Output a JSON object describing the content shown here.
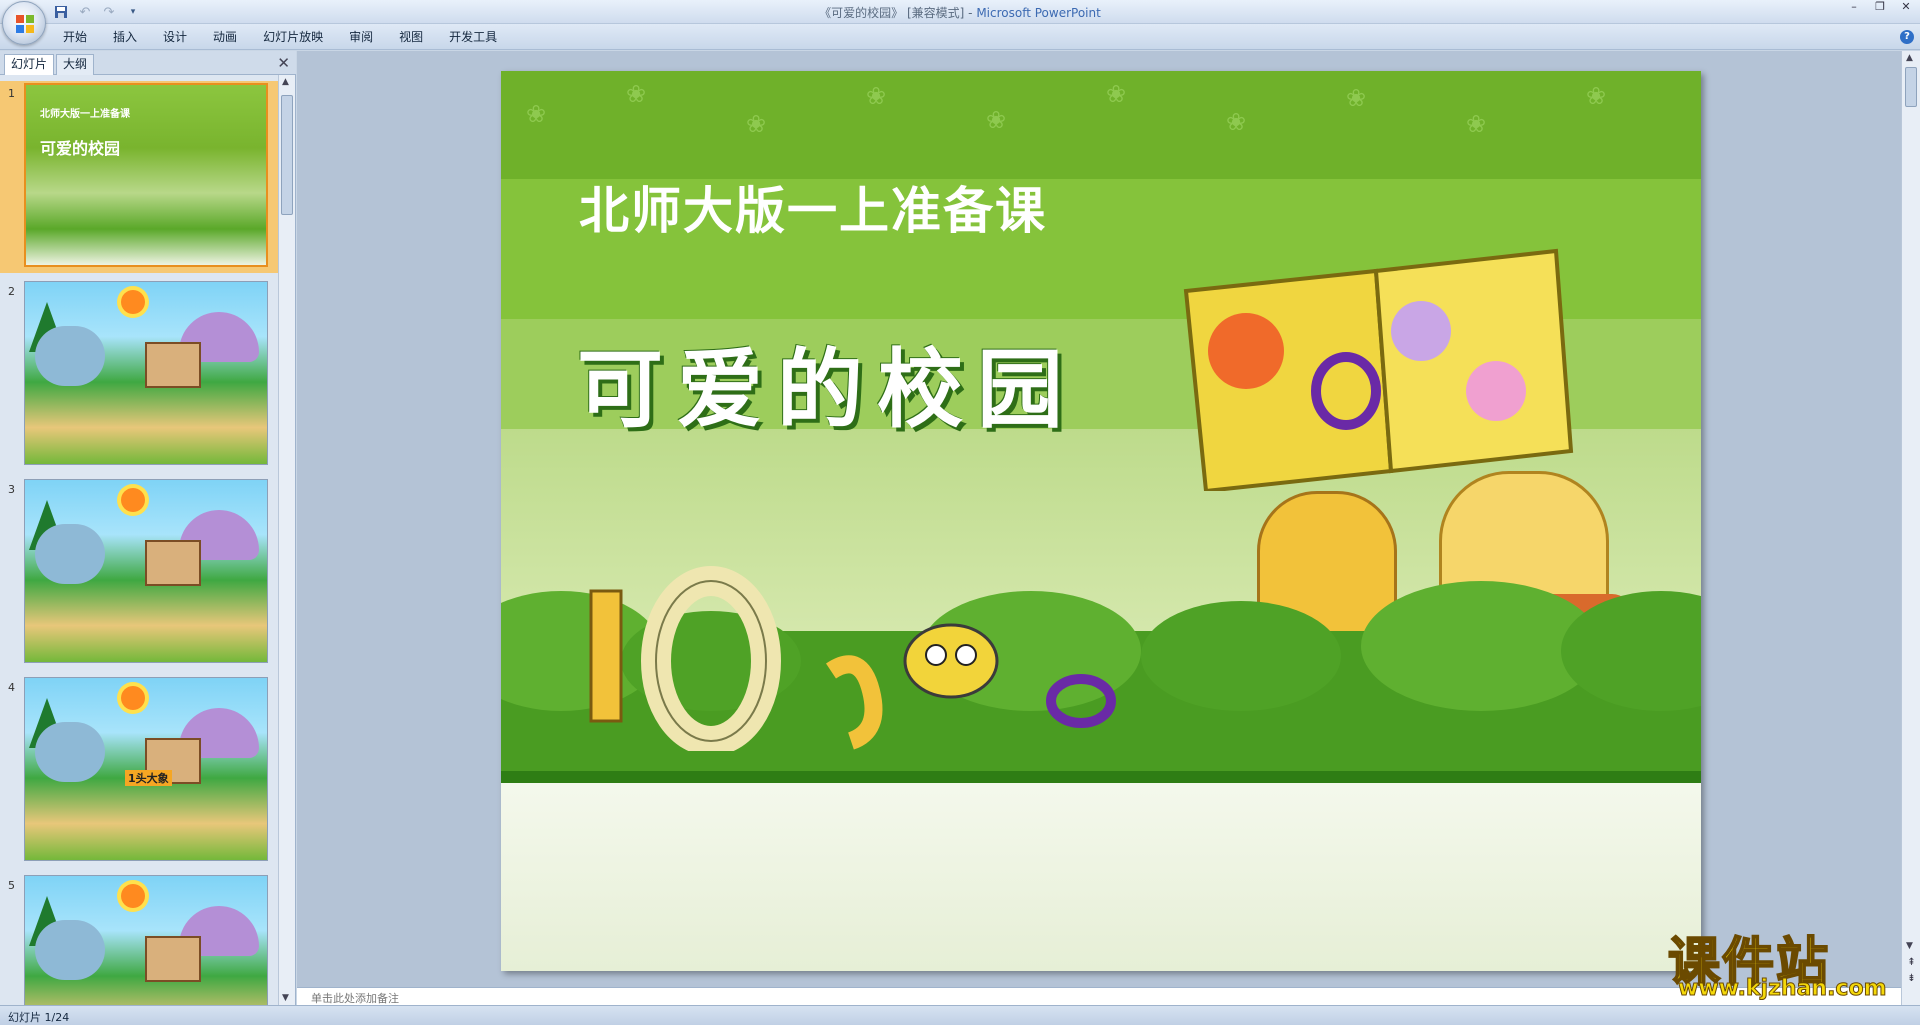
{
  "window": {
    "title_prefix": "《可爱的校园》 [兼容模式] - ",
    "app_name": "Microsoft PowerPoint",
    "minimize": "–",
    "restore": "❐",
    "close": "✕"
  },
  "quick_access": {
    "save_icon": "save-icon",
    "undo_icon": "undo-icon",
    "redo_icon": "redo-icon",
    "customize_icon": "customize-qat-icon"
  },
  "ribbon": {
    "tabs": [
      "开始",
      "插入",
      "设计",
      "动画",
      "幻灯片放映",
      "审阅",
      "视图",
      "开发工具"
    ],
    "help": "?"
  },
  "left_pane": {
    "tab_slides": "幻灯片",
    "tab_outline": "大纲",
    "close": "✕",
    "thumbnails": [
      {
        "num": "1",
        "line1": "北师大版一上准备课",
        "line2": "可爱的校园",
        "selected": true
      },
      {
        "num": "2"
      },
      {
        "num": "3"
      },
      {
        "num": "4",
        "label": "1头大象"
      },
      {
        "num": "5"
      }
    ]
  },
  "slide": {
    "subtitle": "北师大版一上准备课",
    "title": "可爱的校园"
  },
  "notes": {
    "placeholder": "单击此处添加备注"
  },
  "status": {
    "slide_info": "幻灯片 1/24"
  },
  "watermark": {
    "text": "课件站",
    "url": "www.kjzhan.com"
  },
  "colors": {
    "ribbon_bg": "#dfe9f6",
    "slide_green": "#7dbb2f",
    "title_shadow": "#2e6e17",
    "selected_thumb": "#f6c873"
  }
}
